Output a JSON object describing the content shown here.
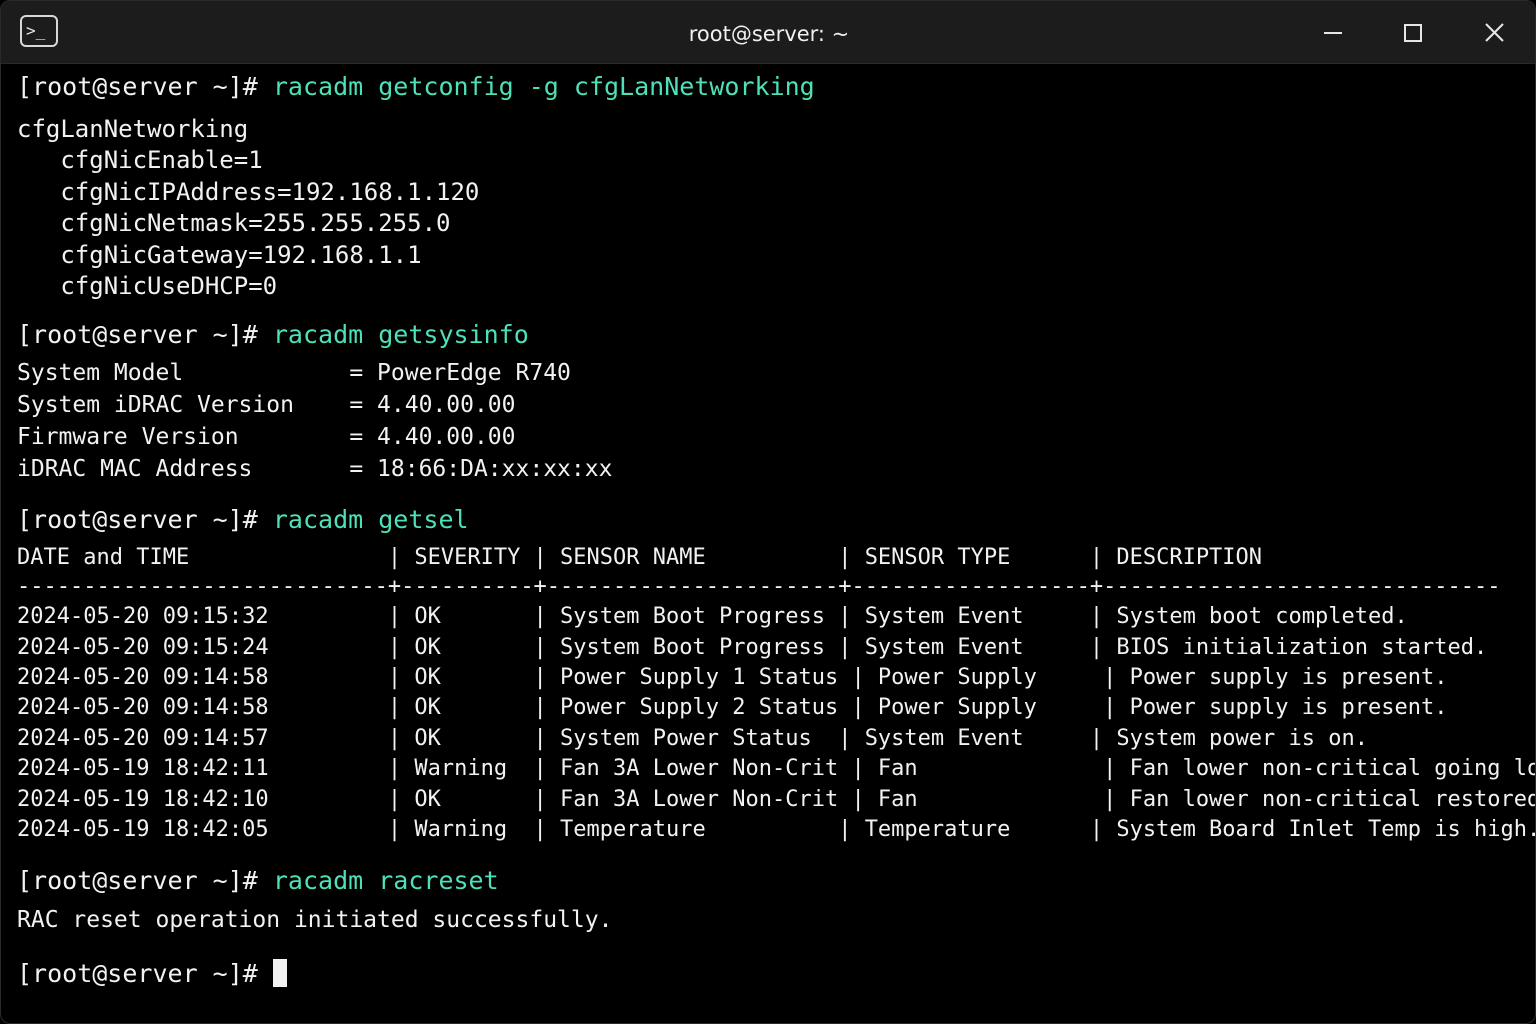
{
  "window": {
    "title": "root@server: ~",
    "app_icon": "terminal-icon",
    "app_icon_glyph": ">_",
    "controls": [
      "minimize-icon",
      "maximize-icon",
      "close-icon"
    ]
  },
  "colors": {
    "background": "#000000",
    "titlebar": "#1c1c1c",
    "text": "#f2f2f2",
    "command": "#4ee0b8"
  },
  "terminal": {
    "prompt": "[root@server ~]# ",
    "blocks": [
      {
        "command": "racadm getconfig -g cfgLanNetworking",
        "output": [
          "cfgLanNetworking",
          "   cfgNicEnable=1",
          "   cfgNicIPAddress=192.168.1.120",
          "   cfgNicNetmask=255.255.255.0",
          "   cfgNicGateway=192.168.1.1",
          "   cfgNicUseDHCP=0"
        ]
      },
      {
        "command": "racadm getsysinfo",
        "output": [
          "System Model            = PowerEdge R740",
          "System iDRAC Version    = 4.40.00.00",
          "Firmware Version        = 4.40.00.00",
          "iDRAC MAC Address       = 18:66:DA:xx:xx:xx"
        ]
      },
      {
        "command": "racadm getsel",
        "output": [
          "DATE and TIME               | SEVERITY | SENSOR NAME          | SENSOR TYPE      | DESCRIPTION",
          "----------------------------+----------+----------------------+------------------+------------------------------",
          "2024-05-20 09:15:32         | OK       | System Boot Progress | System Event     | System boot completed.",
          "2024-05-20 09:15:24         | OK       | System Boot Progress | System Event     | BIOS initialization started.",
          "2024-05-20 09:14:58         | OK       | Power Supply 1 Status | Power Supply     | Power supply is present.",
          "2024-05-20 09:14:58         | OK       | Power Supply 2 Status | Power Supply     | Power supply is present.",
          "2024-05-20 09:14:57         | OK       | System Power Status  | System Event     | System power is on.",
          "2024-05-19 18:42:11         | Warning  | Fan 3A Lower Non-Crit | Fan              | Fan lower non-critical going low.",
          "2024-05-19 18:42:10         | OK       | Fan 3A Lower Non-Crit | Fan              | Fan lower non-critical restored.",
          "2024-05-19 18:42:05         | Warning  | Temperature          | Temperature      | System Board Inlet Temp is high."
        ]
      },
      {
        "command": "racadm racreset",
        "output": [
          "RAC reset operation initiated successfully."
        ]
      }
    ],
    "final_prompt": "[root@server ~]# "
  }
}
